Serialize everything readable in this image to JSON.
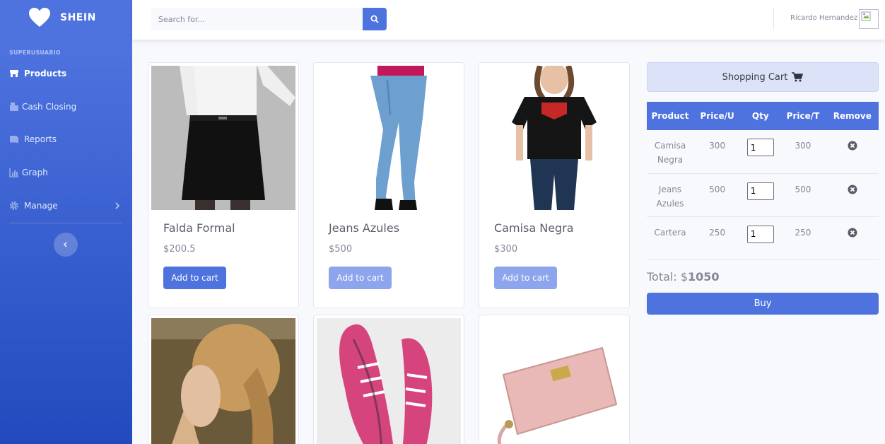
{
  "brand": {
    "name": "SHEIN"
  },
  "sidebar": {
    "heading": "SUPERUSUARIO",
    "items": [
      {
        "label": "Products",
        "icon": "store-icon",
        "active": true
      },
      {
        "label": "Cash Closing",
        "icon": "cash-register-icon"
      },
      {
        "label": "Reports",
        "icon": "receipt-icon"
      },
      {
        "label": "Graph",
        "icon": "chart-icon"
      },
      {
        "label": "Manage",
        "icon": "gear-icon"
      }
    ]
  },
  "search": {
    "placeholder": "Search for..."
  },
  "user": {
    "name": "Ricardo Hernandez"
  },
  "products": [
    {
      "title": "Falda Formal",
      "price": "$200.5",
      "button": "Add to cart"
    },
    {
      "title": "Jeans Azules",
      "price": "$500",
      "button": "Add to cart"
    },
    {
      "title": "Camisa Negra",
      "price": "$300",
      "button": "Add to cart"
    }
  ],
  "cart": {
    "title": "Shopping Cart",
    "columns": [
      "Product",
      "Price/U",
      "Qty",
      "Price/T",
      "Remove"
    ],
    "rows": [
      {
        "product": "Camisa Negra",
        "price_u": "300",
        "qty": "1",
        "price_t": "300"
      },
      {
        "product": "Jeans Azules",
        "price_u": "500",
        "qty": "1",
        "price_t": "500"
      },
      {
        "product": "Cartera",
        "price_u": "250",
        "qty": "1",
        "price_t": "250"
      }
    ],
    "total_label": "Total: $",
    "total_value": "1050",
    "buy_label": "Buy"
  },
  "colors": {
    "primary": "#4e73df",
    "primary_faded": "#8da5ec",
    "sidebar_dark": "#224abe"
  }
}
